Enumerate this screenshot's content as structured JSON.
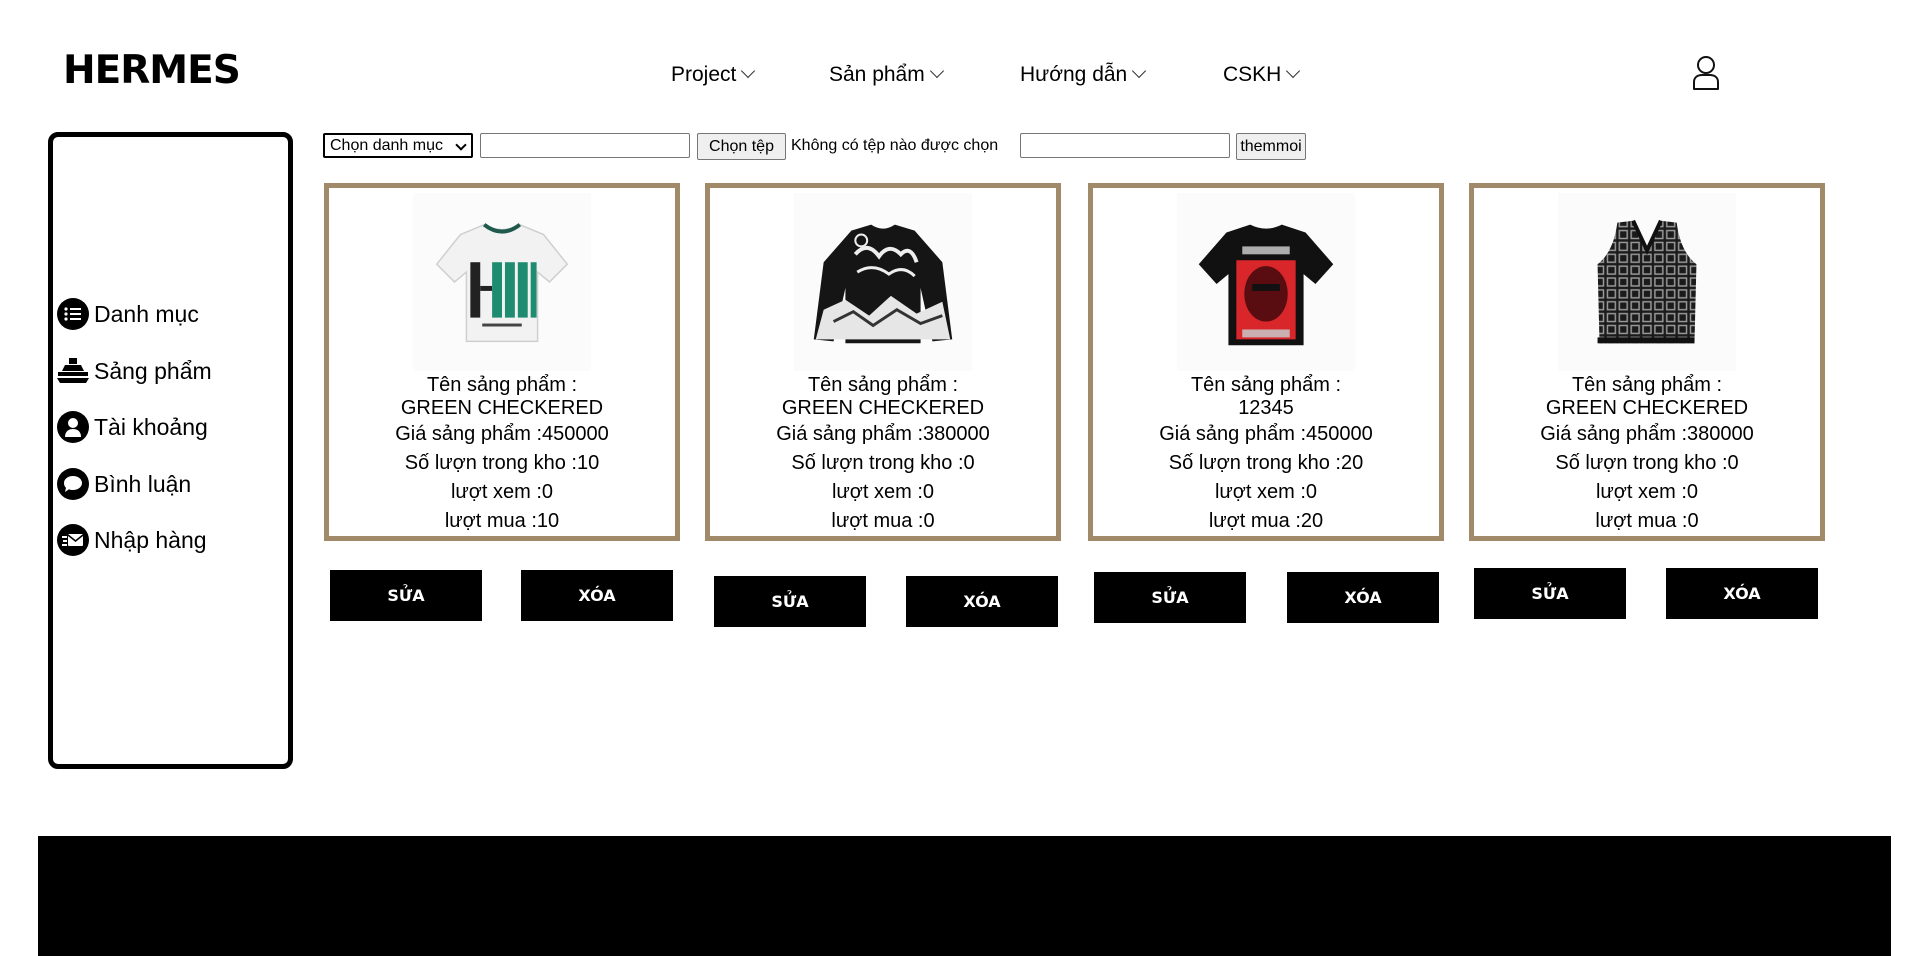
{
  "header": {
    "logo": "HERMES",
    "nav": [
      {
        "label": "Project"
      },
      {
        "label": "Sản phẩm"
      },
      {
        "label": "Hướng dẫn"
      },
      {
        "label": "CSKH"
      }
    ],
    "user_icon": "user-icon"
  },
  "sidebar": {
    "items": [
      {
        "label": "Danh mục",
        "icon": "list-icon"
      },
      {
        "label": "Sảng phẩm",
        "icon": "product-icon"
      },
      {
        "label": "Tài khoảng",
        "icon": "account-icon"
      },
      {
        "label": "Bình luận",
        "icon": "comment-icon"
      },
      {
        "label": "Nhập hàng",
        "icon": "import-icon"
      }
    ]
  },
  "toolbar": {
    "category_select": "Chọn danh mục",
    "name_input_value": "",
    "file_button": "Chọn tệp",
    "file_status": "Không có tệp nào được chọn",
    "price_input_value": "",
    "add_button": "themmoi"
  },
  "products": [
    {
      "name_label": "Tên sảng phẩm :",
      "name": "GREEN CHECKERED",
      "price": "Giá sảng phẩm :450000",
      "stock": "Số lượn trong kho :10",
      "views": "lượt xem :0",
      "buys": "lượt mua :10",
      "image": "white-hades-tshirt",
      "edit": "SỬA",
      "delete": "XÓA"
    },
    {
      "name_label": "Tên sảng phẩm :",
      "name": "GREEN CHECKERED",
      "price": "Giá sảng phẩm :380000",
      "stock": "Số lượn trong kho :0",
      "views": "lượt xem :0",
      "buys": "lượt mua :0",
      "image": "black-graffiti-sweater",
      "edit": "SỬA",
      "delete": "XÓA"
    },
    {
      "name_label": "Tên sảng phẩm :",
      "name": "12345",
      "price": "Giá sảng phẩm :450000",
      "stock": "Số lượn trong kho :20",
      "views": "lượt xem :0",
      "buys": "lượt mua :20",
      "image": "black-red-print-tshirt",
      "edit": "SỬA",
      "delete": "XÓA"
    },
    {
      "name_label": "Tên sảng phẩm :",
      "name": "GREEN CHECKERED",
      "price": "Giá sảng phẩm :380000",
      "stock": "Số lượn trong kho :0",
      "views": "lượt xem :0",
      "buys": "lượt mua :0",
      "image": "knit-checkered-vest",
      "edit": "SỬA",
      "delete": "XÓA"
    }
  ],
  "colors": {
    "card_border": "#a08a69",
    "button_bg": "#000000",
    "footer_bg": "#000000"
  }
}
